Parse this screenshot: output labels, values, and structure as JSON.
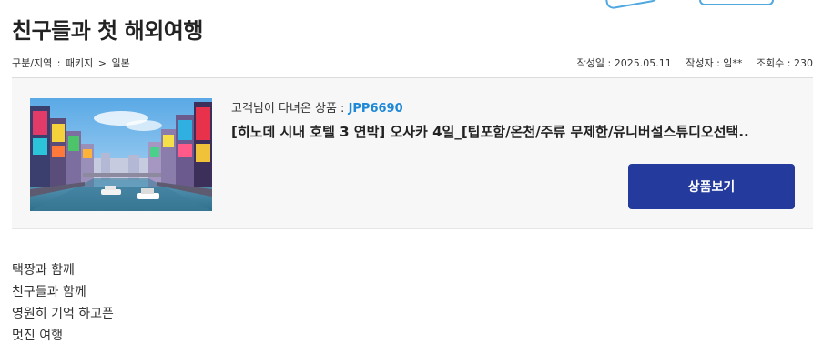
{
  "post": {
    "title": "친구들과 첫 해외여행",
    "category": {
      "label": "구분/지역",
      "type": "패키지",
      "region": "일본"
    },
    "meta": {
      "date_label": "작성일",
      "date": "2025.05.11",
      "author_label": "작성자",
      "author": "임**",
      "views_label": "조회수",
      "views": "230"
    }
  },
  "product": {
    "review_label": "고객님이 다녀온 상품 :",
    "code": "JPP6690",
    "name": "[히노데 시내 호텔 3 연박] 오사카 4일_[팁포함/온천/주류 무제한/유니버설스튜디오선택..",
    "view_button_label": "상품보기",
    "image_alt": "오사카 도톤보리"
  },
  "body_lines": [
    "택짱과 함께",
    "친구들과 함께",
    "영원히 기억 하고픈",
    "멋진 여행"
  ],
  "colors": {
    "accent_button": "#243a9c",
    "code_blue": "#1e88d8"
  }
}
